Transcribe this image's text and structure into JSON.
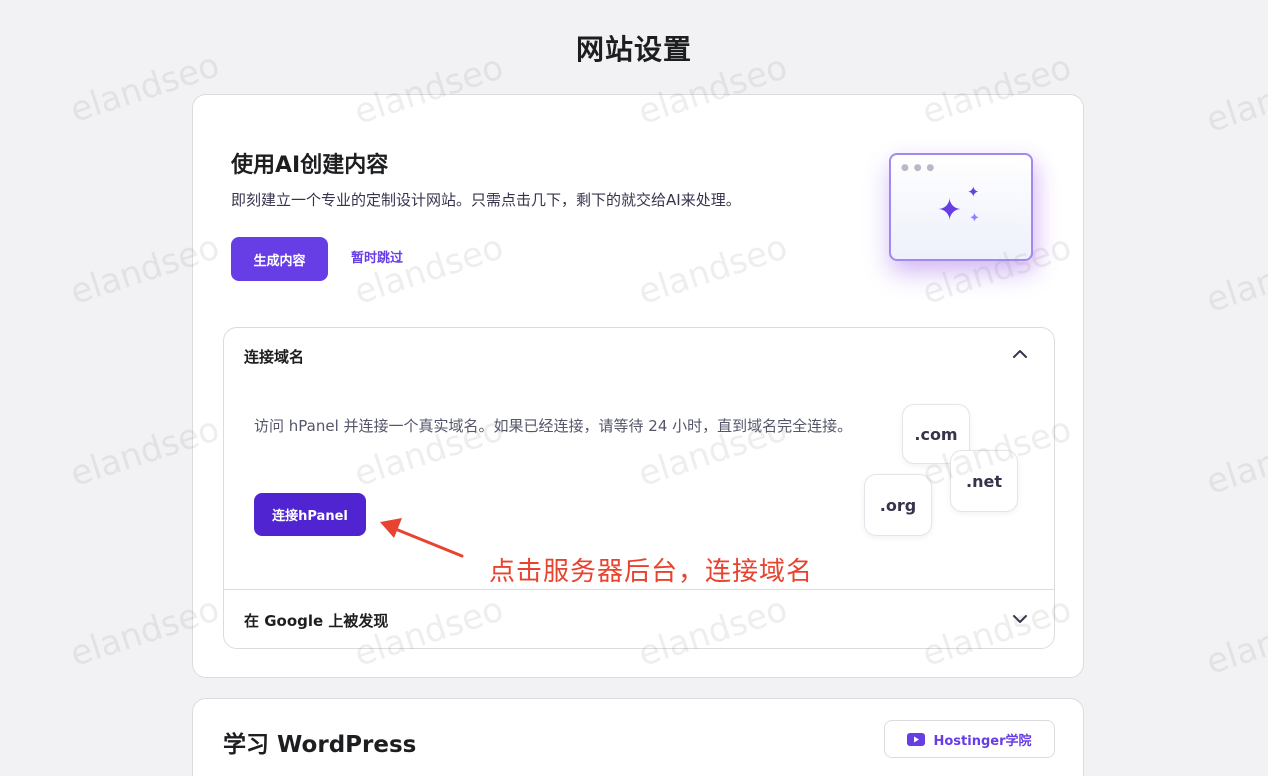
{
  "page": {
    "title": "网站设置"
  },
  "ai_section": {
    "title": "使用AI创建内容",
    "description": "即刻建立一个专业的定制设计网站。只需点击几下，剩下的就交给AI来处理。",
    "generate_label": "生成内容",
    "skip_label": "暂时跳过",
    "illustration_icon": "sparkles-icon"
  },
  "domain_section": {
    "title": "连接域名",
    "description": "访问 hPanel 并连接一个真实域名。如果已经连接，请等待 24 小时，直到域名完全连接。",
    "button_label": "连接hPanel",
    "tlds": [
      ".com",
      ".net",
      ".org"
    ]
  },
  "google_section": {
    "title": "在 Google 上被发现"
  },
  "annotation": {
    "text": "点击服务器后台，连接域名",
    "color": "#e8432f"
  },
  "wordpress_section": {
    "title": "学习 WordPress",
    "academy_label": "Hostinger学院",
    "academy_icon": "youtube-icon"
  },
  "watermark": {
    "text": "elandseo"
  },
  "colors": {
    "accent": "#673de6",
    "accent_dark": "#5025d1",
    "annotation": "#e8432f"
  }
}
